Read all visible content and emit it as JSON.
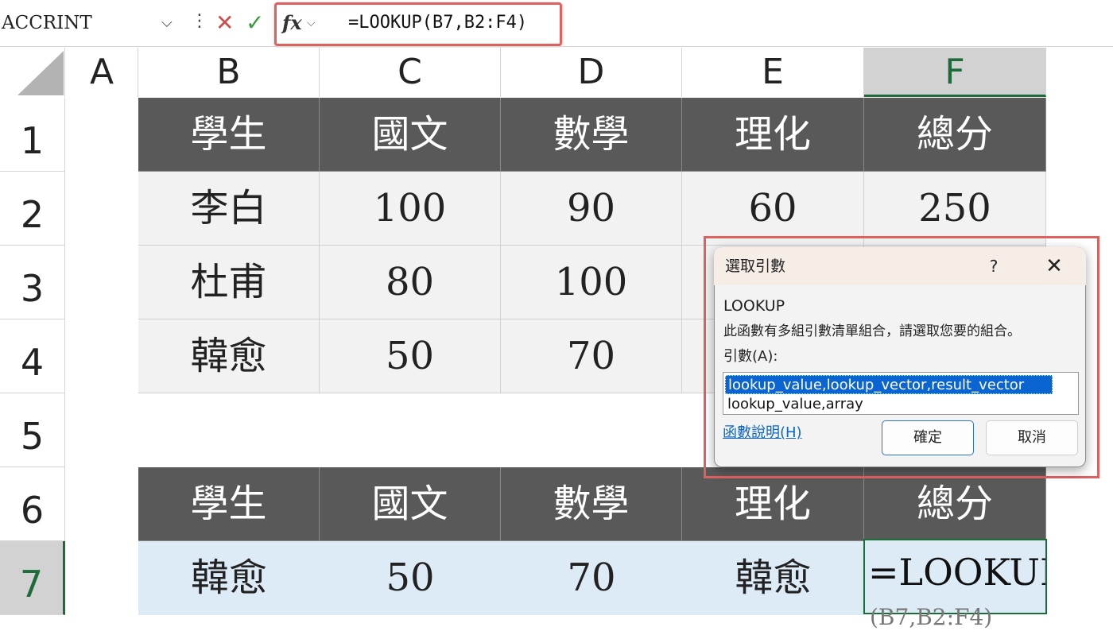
{
  "formula_bar": {
    "name_box": "ACCRINT",
    "dots_glyph": "⋮",
    "cancel_glyph": "✕",
    "enter_glyph": "✓",
    "fx_label": "fx",
    "fx_arrow_glyph": "⌵",
    "formula": "=LOOKUP(B7,B2:F4)"
  },
  "columns": [
    "A",
    "B",
    "C",
    "D",
    "E",
    "F"
  ],
  "selected_column": "F",
  "rows": [
    "1",
    "2",
    "3",
    "4",
    "5",
    "6",
    "7"
  ],
  "selected_row": "7",
  "table": {
    "headers": [
      "學生",
      "國文",
      "數學",
      "理化",
      "總分"
    ],
    "rows": [
      [
        "李白",
        "100",
        "90",
        "60",
        "250"
      ],
      [
        "杜甫",
        "80",
        "100",
        "",
        ""
      ],
      [
        "韓愈",
        "50",
        "70",
        "",
        ""
      ]
    ]
  },
  "lookup_table": {
    "headers": [
      "學生",
      "國文",
      "數學",
      "理化",
      "總分"
    ],
    "row": [
      "韓愈",
      "50",
      "70",
      "韓愈"
    ],
    "active_cell_text": "=LOOKUP",
    "active_cell_overflow": "(B7,B2:F4)"
  },
  "dialog": {
    "title": "選取引數",
    "help_glyph": "?",
    "close_glyph": "✕",
    "function_name": "LOOKUP",
    "description": "此函數有多組引數清單組合，請選取您要的組合。",
    "args_label": "引數(A):",
    "options": [
      "lookup_value,lookup_vector,result_vector",
      "lookup_value,array"
    ],
    "help_link": "函數說明(H)",
    "ok_label": "確定",
    "cancel_label": "取消"
  },
  "colors": {
    "highlight_border": "#e06060",
    "header_fill": "#595959",
    "data_fill": "#f2f2f2",
    "blue_fill": "#ddebf7",
    "selection_green": "#1e6b3a",
    "selection_blue": "#0a64d2"
  }
}
